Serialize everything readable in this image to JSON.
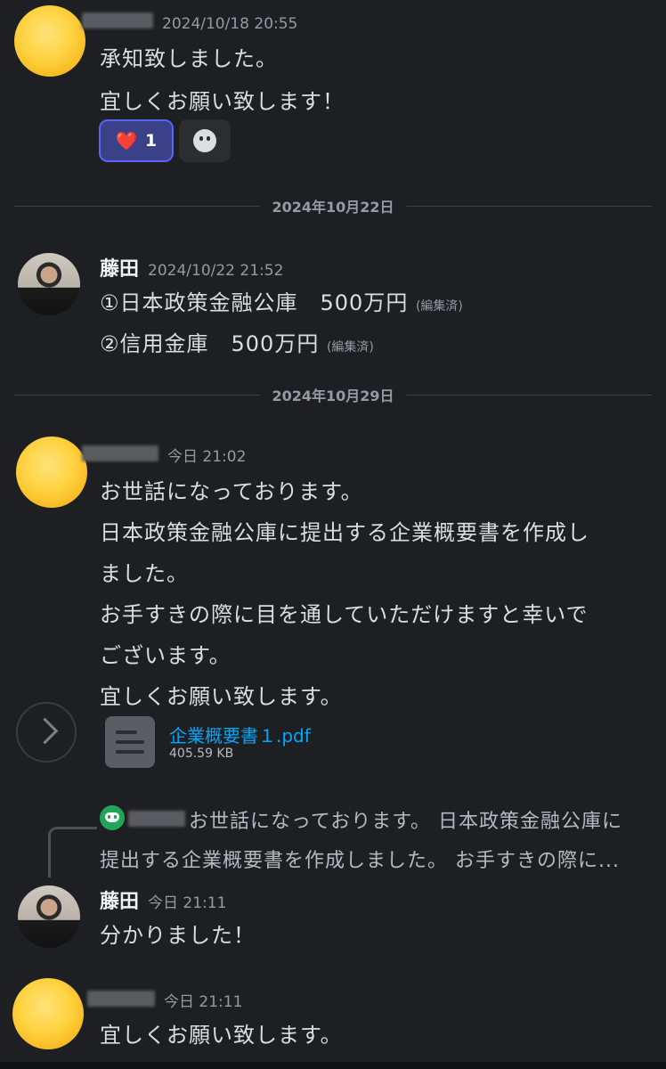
{
  "colors": {
    "background": "#1e1f22",
    "text": "#dbdee1",
    "muted": "#949ba4",
    "link": "#00a8fc",
    "accent": "#5865f2"
  },
  "messages": [
    {
      "author": "",
      "timestamp": "2024/10/18 20:55",
      "avatar": "smiling-face-emoji",
      "lines": [
        "承知致しました。",
        "宜しくお願い致します！"
      ],
      "reactions": [
        {
          "emoji": "❤️",
          "count": "1"
        }
      ]
    },
    {
      "author": "藤田",
      "timestamp": "2024/10/22 21:52",
      "avatar": "user-photo",
      "lines": [
        "①日本政策金融公庫　500万円",
        "②信用金庫　500万円"
      ],
      "edited": "(編集済)"
    },
    {
      "author": "",
      "timestamp": "今日 21:02",
      "avatar": "smiling-face-emoji",
      "lines": [
        "お世話になっております。",
        "日本政策金融公庫に提出する企業概要書を作成し",
        "ました。",
        "お手すきの際に目を通していただけますと幸いで",
        "ございます。",
        "宜しくお願い致します。"
      ],
      "attachment": {
        "name": "企業概要書１.pdf",
        "size": "405.59 KB",
        "icon": "file-icon"
      }
    },
    {
      "author": "藤田",
      "timestamp": "今日 21:11",
      "avatar": "user-photo",
      "reply": {
        "lines": [
          "お世話になっております。 日本政策金融公庫に",
          "提出する企業概要書を作成しました。 お手すきの際に..."
        ]
      },
      "lines": [
        "分かりました！"
      ]
    },
    {
      "author": "",
      "timestamp": "今日 21:11",
      "avatar": "smiling-face-emoji",
      "lines": [
        "宜しくお願い致します。"
      ]
    }
  ],
  "dividers": [
    "2024年10月22日",
    "2024年10月29日"
  ]
}
